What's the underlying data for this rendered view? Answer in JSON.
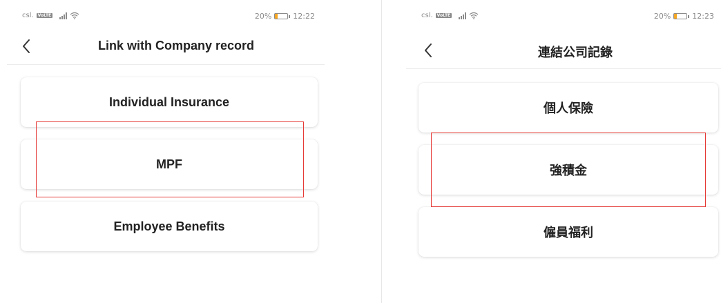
{
  "screens": [
    {
      "status_bar": {
        "carrier": "csl.",
        "volte_badge": "VoLTE",
        "battery": "20%",
        "time": "12:22",
        "battery_level": 0.2
      },
      "header": {
        "title": "Link with Company record"
      },
      "menu": [
        {
          "label": "Individual Insurance"
        },
        {
          "label": "MPF"
        },
        {
          "label": "Employee Benefits"
        }
      ]
    },
    {
      "status_bar": {
        "carrier": "csl.",
        "volte_badge": "VoLTE",
        "battery": "20%",
        "time": "12:23",
        "battery_level": 0.2
      },
      "header": {
        "title": "連結公司記錄"
      },
      "menu": [
        {
          "label": "個人保險"
        },
        {
          "label": "強積金"
        },
        {
          "label": "僱員福利"
        }
      ]
    }
  ],
  "colors": {
    "highlight": "#e53935",
    "battery_fill": "#f5a623",
    "status_text": "#8a8a8a"
  },
  "icons": {
    "back": "chevron-left-icon",
    "wifi": "wifi-icon",
    "signal": "signal-icon",
    "battery": "battery-icon"
  }
}
